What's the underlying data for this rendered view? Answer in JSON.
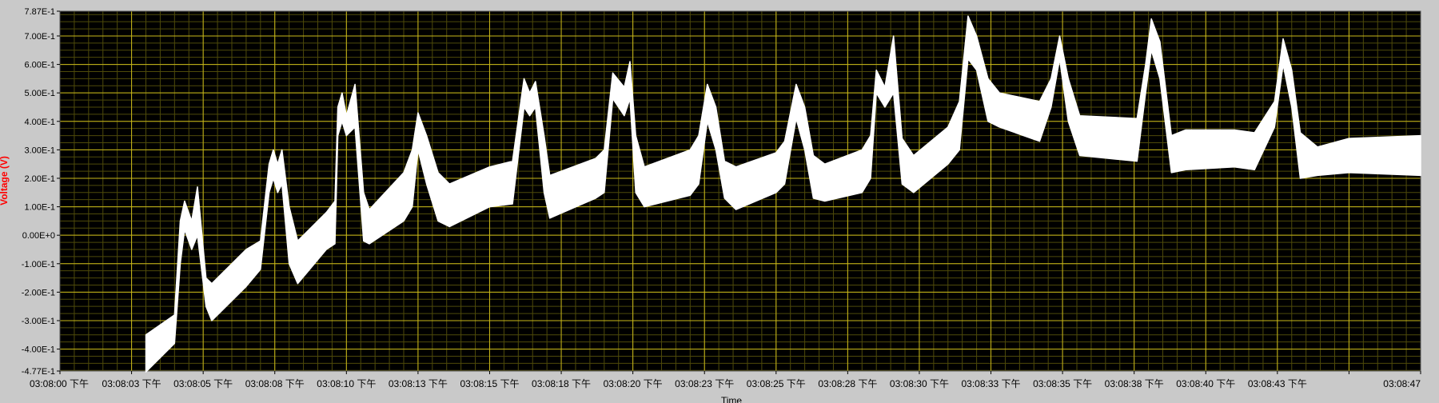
{
  "chart_data": {
    "type": "line",
    "ylabel": "Voltage (V)",
    "xlabel": "Time",
    "ylim": [
      -0.477,
      0.787
    ],
    "xlim_seconds_from_first_tick": [
      0,
      47.5
    ],
    "y_ticks": [
      {
        "v": 0.787,
        "label": "7.87E-1"
      },
      {
        "v": 0.7,
        "label": "7.00E-1"
      },
      {
        "v": 0.6,
        "label": "6.00E-1"
      },
      {
        "v": 0.5,
        "label": "5.00E-1"
      },
      {
        "v": 0.4,
        "label": "4.00E-1"
      },
      {
        "v": 0.3,
        "label": "3.00E-1"
      },
      {
        "v": 0.2,
        "label": "2.00E-1"
      },
      {
        "v": 0.1,
        "label": "1.00E-1"
      },
      {
        "v": 0.0,
        "label": "0.00E+0"
      },
      {
        "v": -0.1,
        "label": "-1.00E-1"
      },
      {
        "v": -0.2,
        "label": "-2.00E-1"
      },
      {
        "v": -0.3,
        "label": "-3.00E-1"
      },
      {
        "v": -0.4,
        "label": "-4.00E-1"
      },
      {
        "v": -0.477,
        "label": "-4.77E-1"
      }
    ],
    "x_ticks": [
      {
        "t": 0.0,
        "label": "03:08:00 下午"
      },
      {
        "t": 2.5,
        "label": "03:08:03 下午"
      },
      {
        "t": 5.0,
        "label": "03:08:05 下午"
      },
      {
        "t": 7.5,
        "label": "03:08:08 下午"
      },
      {
        "t": 10.0,
        "label": "03:08:10 下午"
      },
      {
        "t": 12.5,
        "label": "03:08:13 下午"
      },
      {
        "t": 15.0,
        "label": "03:08:15 下午"
      },
      {
        "t": 17.5,
        "label": "03:08:18 下午"
      },
      {
        "t": 20.0,
        "label": "03:08:20 下午"
      },
      {
        "t": 22.5,
        "label": "03:08:23 下午"
      },
      {
        "t": 25.0,
        "label": "03:08:25 下午"
      },
      {
        "t": 27.5,
        "label": "03:08:28 下午"
      },
      {
        "t": 30.0,
        "label": "03:08:30 下午"
      },
      {
        "t": 32.5,
        "label": "03:08:33 下午"
      },
      {
        "t": 35.0,
        "label": "03:08:35 下午"
      },
      {
        "t": 37.5,
        "label": "03:08:38 下午"
      },
      {
        "t": 40.0,
        "label": "03:08:40 下午"
      },
      {
        "t": 42.5,
        "label": "03:08:43 下午"
      },
      {
        "t": 45.0,
        "label": ""
      },
      {
        "t": 47.5,
        "label": "03:08:47"
      }
    ],
    "grid": true,
    "series": [
      {
        "envelope_upper": [
          [
            3.0,
            -0.35
          ],
          [
            4.0,
            -0.28
          ],
          [
            4.2,
            0.05
          ],
          [
            4.35,
            0.12
          ],
          [
            4.6,
            0.05
          ],
          [
            4.8,
            0.17
          ],
          [
            5.1,
            -0.15
          ],
          [
            5.3,
            -0.17
          ],
          [
            6.5,
            -0.05
          ],
          [
            7.0,
            -0.02
          ],
          [
            7.3,
            0.25
          ],
          [
            7.45,
            0.3
          ],
          [
            7.6,
            0.25
          ],
          [
            7.75,
            0.3
          ],
          [
            8.0,
            0.1
          ],
          [
            8.3,
            -0.02
          ],
          [
            9.3,
            0.08
          ],
          [
            9.6,
            0.12
          ],
          [
            9.7,
            0.45
          ],
          [
            9.85,
            0.5
          ],
          [
            10.0,
            0.42
          ],
          [
            10.3,
            0.53
          ],
          [
            10.6,
            0.15
          ],
          [
            10.8,
            0.09
          ],
          [
            12.0,
            0.22
          ],
          [
            12.3,
            0.3
          ],
          [
            12.5,
            0.43
          ],
          [
            12.8,
            0.35
          ],
          [
            13.2,
            0.22
          ],
          [
            13.6,
            0.18
          ],
          [
            15.0,
            0.24
          ],
          [
            15.8,
            0.26
          ],
          [
            16.2,
            0.55
          ],
          [
            16.4,
            0.5
          ],
          [
            16.6,
            0.54
          ],
          [
            16.9,
            0.35
          ],
          [
            17.1,
            0.21
          ],
          [
            18.7,
            0.27
          ],
          [
            19.0,
            0.3
          ],
          [
            19.3,
            0.57
          ],
          [
            19.7,
            0.52
          ],
          [
            19.9,
            0.61
          ],
          [
            20.1,
            0.35
          ],
          [
            20.4,
            0.24
          ],
          [
            22.0,
            0.3
          ],
          [
            22.3,
            0.35
          ],
          [
            22.6,
            0.53
          ],
          [
            22.9,
            0.45
          ],
          [
            23.2,
            0.26
          ],
          [
            23.6,
            0.24
          ],
          [
            25.0,
            0.29
          ],
          [
            25.3,
            0.33
          ],
          [
            25.7,
            0.53
          ],
          [
            26.0,
            0.45
          ],
          [
            26.3,
            0.28
          ],
          [
            26.7,
            0.25
          ],
          [
            28.0,
            0.3
          ],
          [
            28.3,
            0.35
          ],
          [
            28.5,
            0.58
          ],
          [
            28.8,
            0.52
          ],
          [
            29.1,
            0.7
          ],
          [
            29.4,
            0.34
          ],
          [
            29.8,
            0.28
          ],
          [
            31.0,
            0.38
          ],
          [
            31.4,
            0.47
          ],
          [
            31.7,
            0.77
          ],
          [
            32.0,
            0.7
          ],
          [
            32.4,
            0.55
          ],
          [
            32.8,
            0.5
          ],
          [
            34.2,
            0.47
          ],
          [
            34.6,
            0.55
          ],
          [
            34.9,
            0.7
          ],
          [
            35.2,
            0.55
          ],
          [
            35.6,
            0.42
          ],
          [
            37.6,
            0.41
          ],
          [
            37.9,
            0.6
          ],
          [
            38.1,
            0.76
          ],
          [
            38.4,
            0.68
          ],
          [
            38.8,
            0.35
          ],
          [
            39.3,
            0.37
          ],
          [
            41.0,
            0.37
          ],
          [
            41.7,
            0.36
          ],
          [
            42.4,
            0.47
          ],
          [
            42.7,
            0.69
          ],
          [
            43.0,
            0.58
          ],
          [
            43.3,
            0.36
          ],
          [
            43.9,
            0.31
          ],
          [
            45.0,
            0.34
          ],
          [
            47.5,
            0.35
          ]
        ],
        "envelope_lower": [
          [
            3.0,
            -0.48
          ],
          [
            4.0,
            -0.38
          ],
          [
            4.2,
            -0.1
          ],
          [
            4.35,
            0.02
          ],
          [
            4.6,
            -0.05
          ],
          [
            4.8,
            0.0
          ],
          [
            5.1,
            -0.25
          ],
          [
            5.3,
            -0.3
          ],
          [
            6.5,
            -0.18
          ],
          [
            7.0,
            -0.12
          ],
          [
            7.3,
            0.15
          ],
          [
            7.45,
            0.2
          ],
          [
            7.6,
            0.15
          ],
          [
            7.75,
            0.18
          ],
          [
            8.0,
            -0.1
          ],
          [
            8.3,
            -0.17
          ],
          [
            9.3,
            -0.05
          ],
          [
            9.6,
            -0.03
          ],
          [
            9.7,
            0.35
          ],
          [
            9.85,
            0.4
          ],
          [
            10.0,
            0.35
          ],
          [
            10.3,
            0.38
          ],
          [
            10.6,
            -0.02
          ],
          [
            10.8,
            -0.03
          ],
          [
            12.0,
            0.05
          ],
          [
            12.3,
            0.1
          ],
          [
            12.5,
            0.3
          ],
          [
            12.8,
            0.18
          ],
          [
            13.2,
            0.05
          ],
          [
            13.6,
            0.03
          ],
          [
            15.0,
            0.1
          ],
          [
            15.8,
            0.11
          ],
          [
            16.2,
            0.45
          ],
          [
            16.4,
            0.42
          ],
          [
            16.6,
            0.45
          ],
          [
            16.9,
            0.15
          ],
          [
            17.1,
            0.06
          ],
          [
            18.7,
            0.13
          ],
          [
            19.0,
            0.15
          ],
          [
            19.3,
            0.48
          ],
          [
            19.7,
            0.42
          ],
          [
            19.9,
            0.48
          ],
          [
            20.1,
            0.15
          ],
          [
            20.4,
            0.1
          ],
          [
            22.0,
            0.14
          ],
          [
            22.3,
            0.18
          ],
          [
            22.6,
            0.4
          ],
          [
            22.9,
            0.3
          ],
          [
            23.2,
            0.13
          ],
          [
            23.6,
            0.09
          ],
          [
            25.0,
            0.15
          ],
          [
            25.3,
            0.18
          ],
          [
            25.7,
            0.41
          ],
          [
            26.0,
            0.3
          ],
          [
            26.3,
            0.13
          ],
          [
            26.7,
            0.12
          ],
          [
            28.0,
            0.15
          ],
          [
            28.3,
            0.2
          ],
          [
            28.5,
            0.5
          ],
          [
            28.8,
            0.45
          ],
          [
            29.1,
            0.5
          ],
          [
            29.4,
            0.18
          ],
          [
            29.8,
            0.15
          ],
          [
            31.0,
            0.25
          ],
          [
            31.4,
            0.3
          ],
          [
            31.7,
            0.62
          ],
          [
            32.0,
            0.58
          ],
          [
            32.4,
            0.4
          ],
          [
            32.8,
            0.38
          ],
          [
            34.2,
            0.33
          ],
          [
            34.6,
            0.45
          ],
          [
            34.9,
            0.62
          ],
          [
            35.2,
            0.4
          ],
          [
            35.6,
            0.28
          ],
          [
            37.6,
            0.26
          ],
          [
            37.9,
            0.5
          ],
          [
            38.1,
            0.65
          ],
          [
            38.4,
            0.55
          ],
          [
            38.8,
            0.22
          ],
          [
            39.3,
            0.23
          ],
          [
            41.0,
            0.24
          ],
          [
            41.7,
            0.23
          ],
          [
            42.4,
            0.38
          ],
          [
            42.7,
            0.6
          ],
          [
            43.0,
            0.45
          ],
          [
            43.3,
            0.2
          ],
          [
            43.9,
            0.21
          ],
          [
            45.0,
            0.22
          ],
          [
            47.5,
            0.21
          ]
        ]
      }
    ]
  },
  "colors": {
    "plot_bg": "#000000",
    "major_grid": "#c9b81a",
    "minor_grid": "#4e4a0a",
    "trace": "#ffffff",
    "frame_bg": "#c9c9c9",
    "ylabel": "#ff0000"
  }
}
